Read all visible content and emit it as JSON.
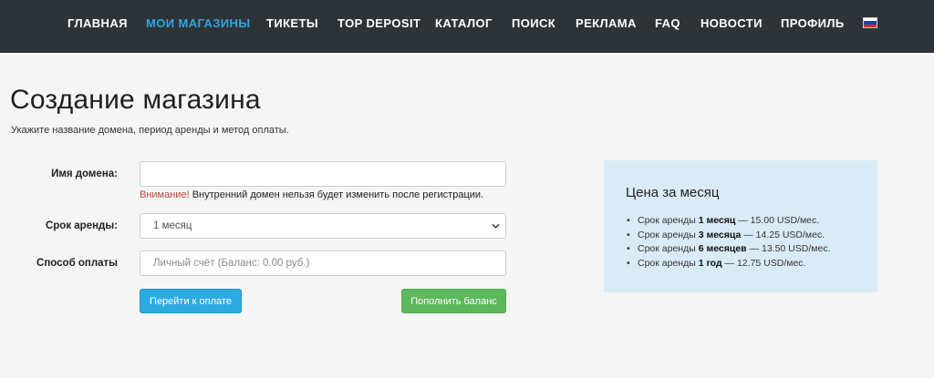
{
  "nav": {
    "items": [
      {
        "label": "Главная"
      },
      {
        "label": "Мои магазины"
      },
      {
        "label": "Тикеты"
      },
      {
        "label": "TOP DEPOSIT"
      },
      {
        "label": "Каталог"
      },
      {
        "label": "Поиск"
      },
      {
        "label": "Реклама"
      },
      {
        "label": "FAQ"
      },
      {
        "label": "Новости"
      },
      {
        "label": "Профиль"
      }
    ],
    "active_index": 1,
    "active_color": "#2ca8e3",
    "background_color": "#2e3338",
    "language_icon": "flag-ru-icon"
  },
  "page": {
    "title": "Создание магазина",
    "subtitle": "Укажите название домена, период аренды и метод оплаты."
  },
  "form": {
    "domain": {
      "label": "Имя домена:",
      "value": "",
      "warning_strong": "Внимание!",
      "warning_text": " Внутренний домен нельзя будет изменить после регистрации."
    },
    "term": {
      "label": "Срок аренды:",
      "selected": "1 месяц"
    },
    "payment": {
      "label": "Способ оплаты",
      "placeholder": "Личный счёт (Баланс: 0.00 руб.)"
    },
    "pay_button": "Перейти к оплате",
    "topup_button": "Пополнить баланс"
  },
  "price": {
    "title": "Цена за месяц",
    "rows": [
      {
        "pre": "Срок аренды ",
        "term": "1 месяц",
        "price": " — 15.00 USD/мес."
      },
      {
        "pre": "Срок аренды ",
        "term": "3 месяца",
        "price": " — 14.25 USD/мес."
      },
      {
        "pre": "Срок аренды ",
        "term": "6 месяцев",
        "price": " — 13.50 USD/мес."
      },
      {
        "pre": "Срок аренды ",
        "term": "1 год",
        "price": " — 12.75 USD/мес."
      }
    ]
  }
}
